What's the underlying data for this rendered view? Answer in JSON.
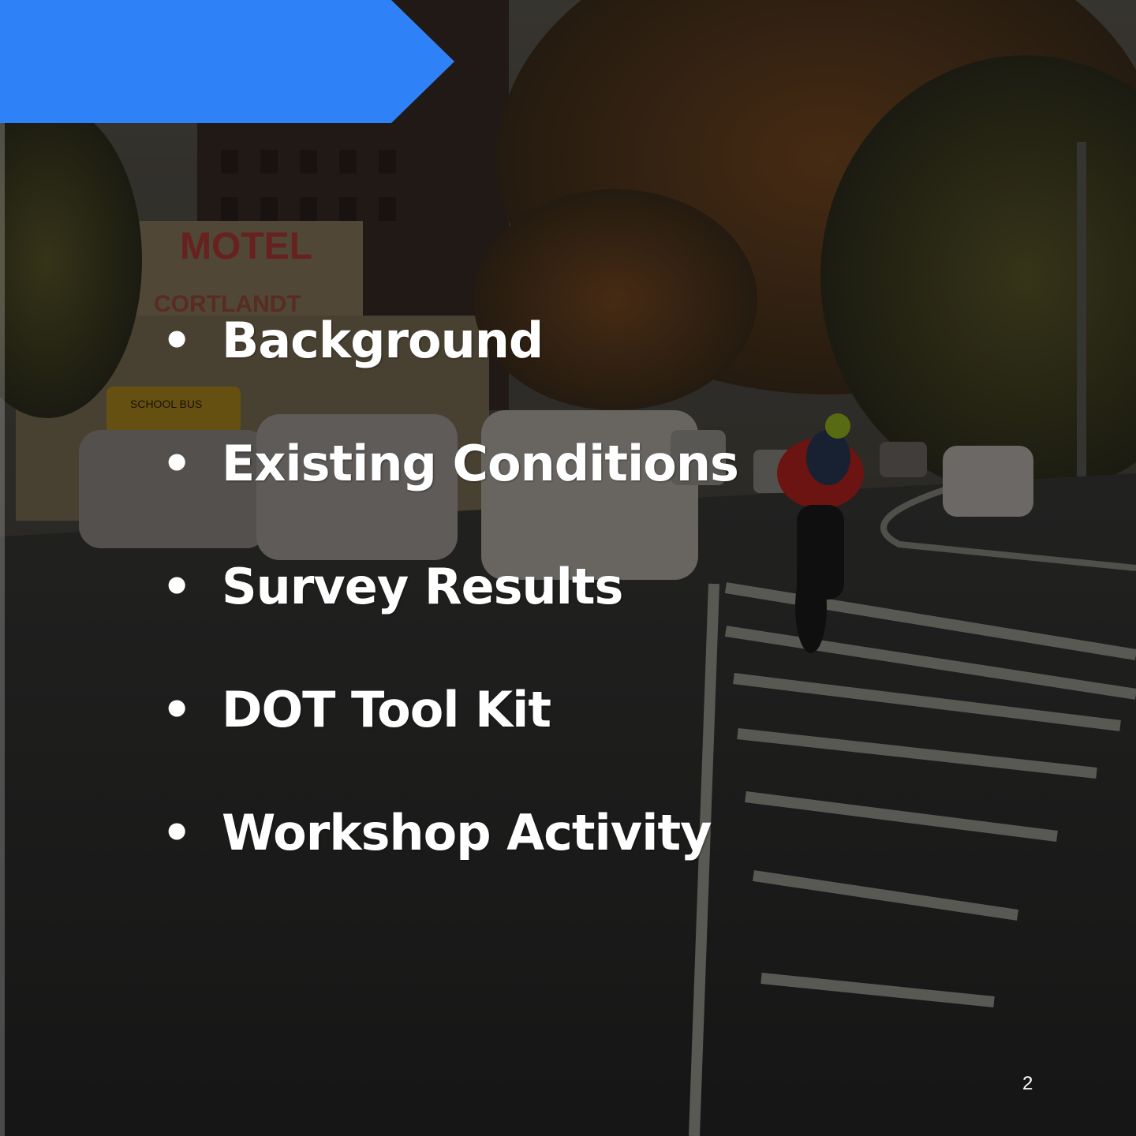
{
  "slide": {
    "bullets": [
      {
        "label": "Background"
      },
      {
        "label": "Existing Conditions"
      },
      {
        "label": "Survey Results"
      },
      {
        "label": "DOT Tool Kit"
      },
      {
        "label": "Workshop Activity"
      }
    ],
    "page_number": "2",
    "bullet_glyph": "•",
    "photo_sign_text": "MOTEL",
    "photo_sign_text_2": "CORTLANDT",
    "photo_bus_text": "SCHOOL BUS"
  },
  "colors": {
    "banner": "#2f81f7",
    "text": "#ffffff",
    "overlay": "#000000"
  },
  "icons": {
    "banner": "chevron-arrow-banner"
  }
}
